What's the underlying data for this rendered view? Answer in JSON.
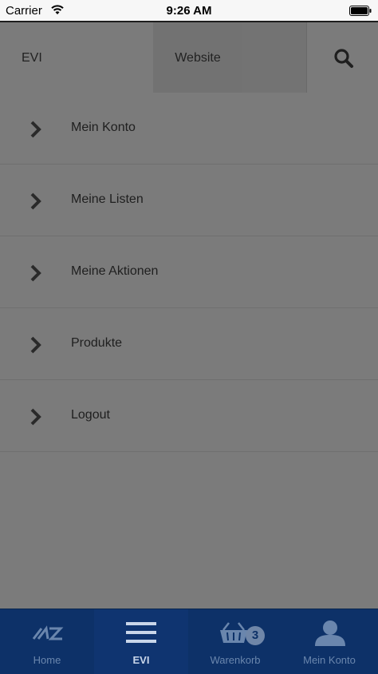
{
  "status": {
    "carrier": "Carrier",
    "time": "9:26 AM"
  },
  "topnav": {
    "evi": "EVI",
    "website": "Website"
  },
  "menu": {
    "items": [
      {
        "label": "Mein Konto"
      },
      {
        "label": "Meine Listen"
      },
      {
        "label": "Meine Aktionen"
      },
      {
        "label": "Produkte"
      },
      {
        "label": "Logout"
      }
    ]
  },
  "tabbar": {
    "tabs": [
      {
        "label": "Home",
        "icon": "home-logo-icon"
      },
      {
        "label": "EVI",
        "icon": "hamburger-icon",
        "active": true
      },
      {
        "label": "Warenkorb",
        "icon": "basket-icon"
      },
      {
        "label": "Mein Konto",
        "icon": "person-icon"
      }
    ],
    "basket_badge": "3"
  },
  "colors": {
    "overlay": "#7b7b7b",
    "tabbar": "#0d3168",
    "tab_inactive": "#6a86ad",
    "tab_active": "#c9d6ea"
  }
}
